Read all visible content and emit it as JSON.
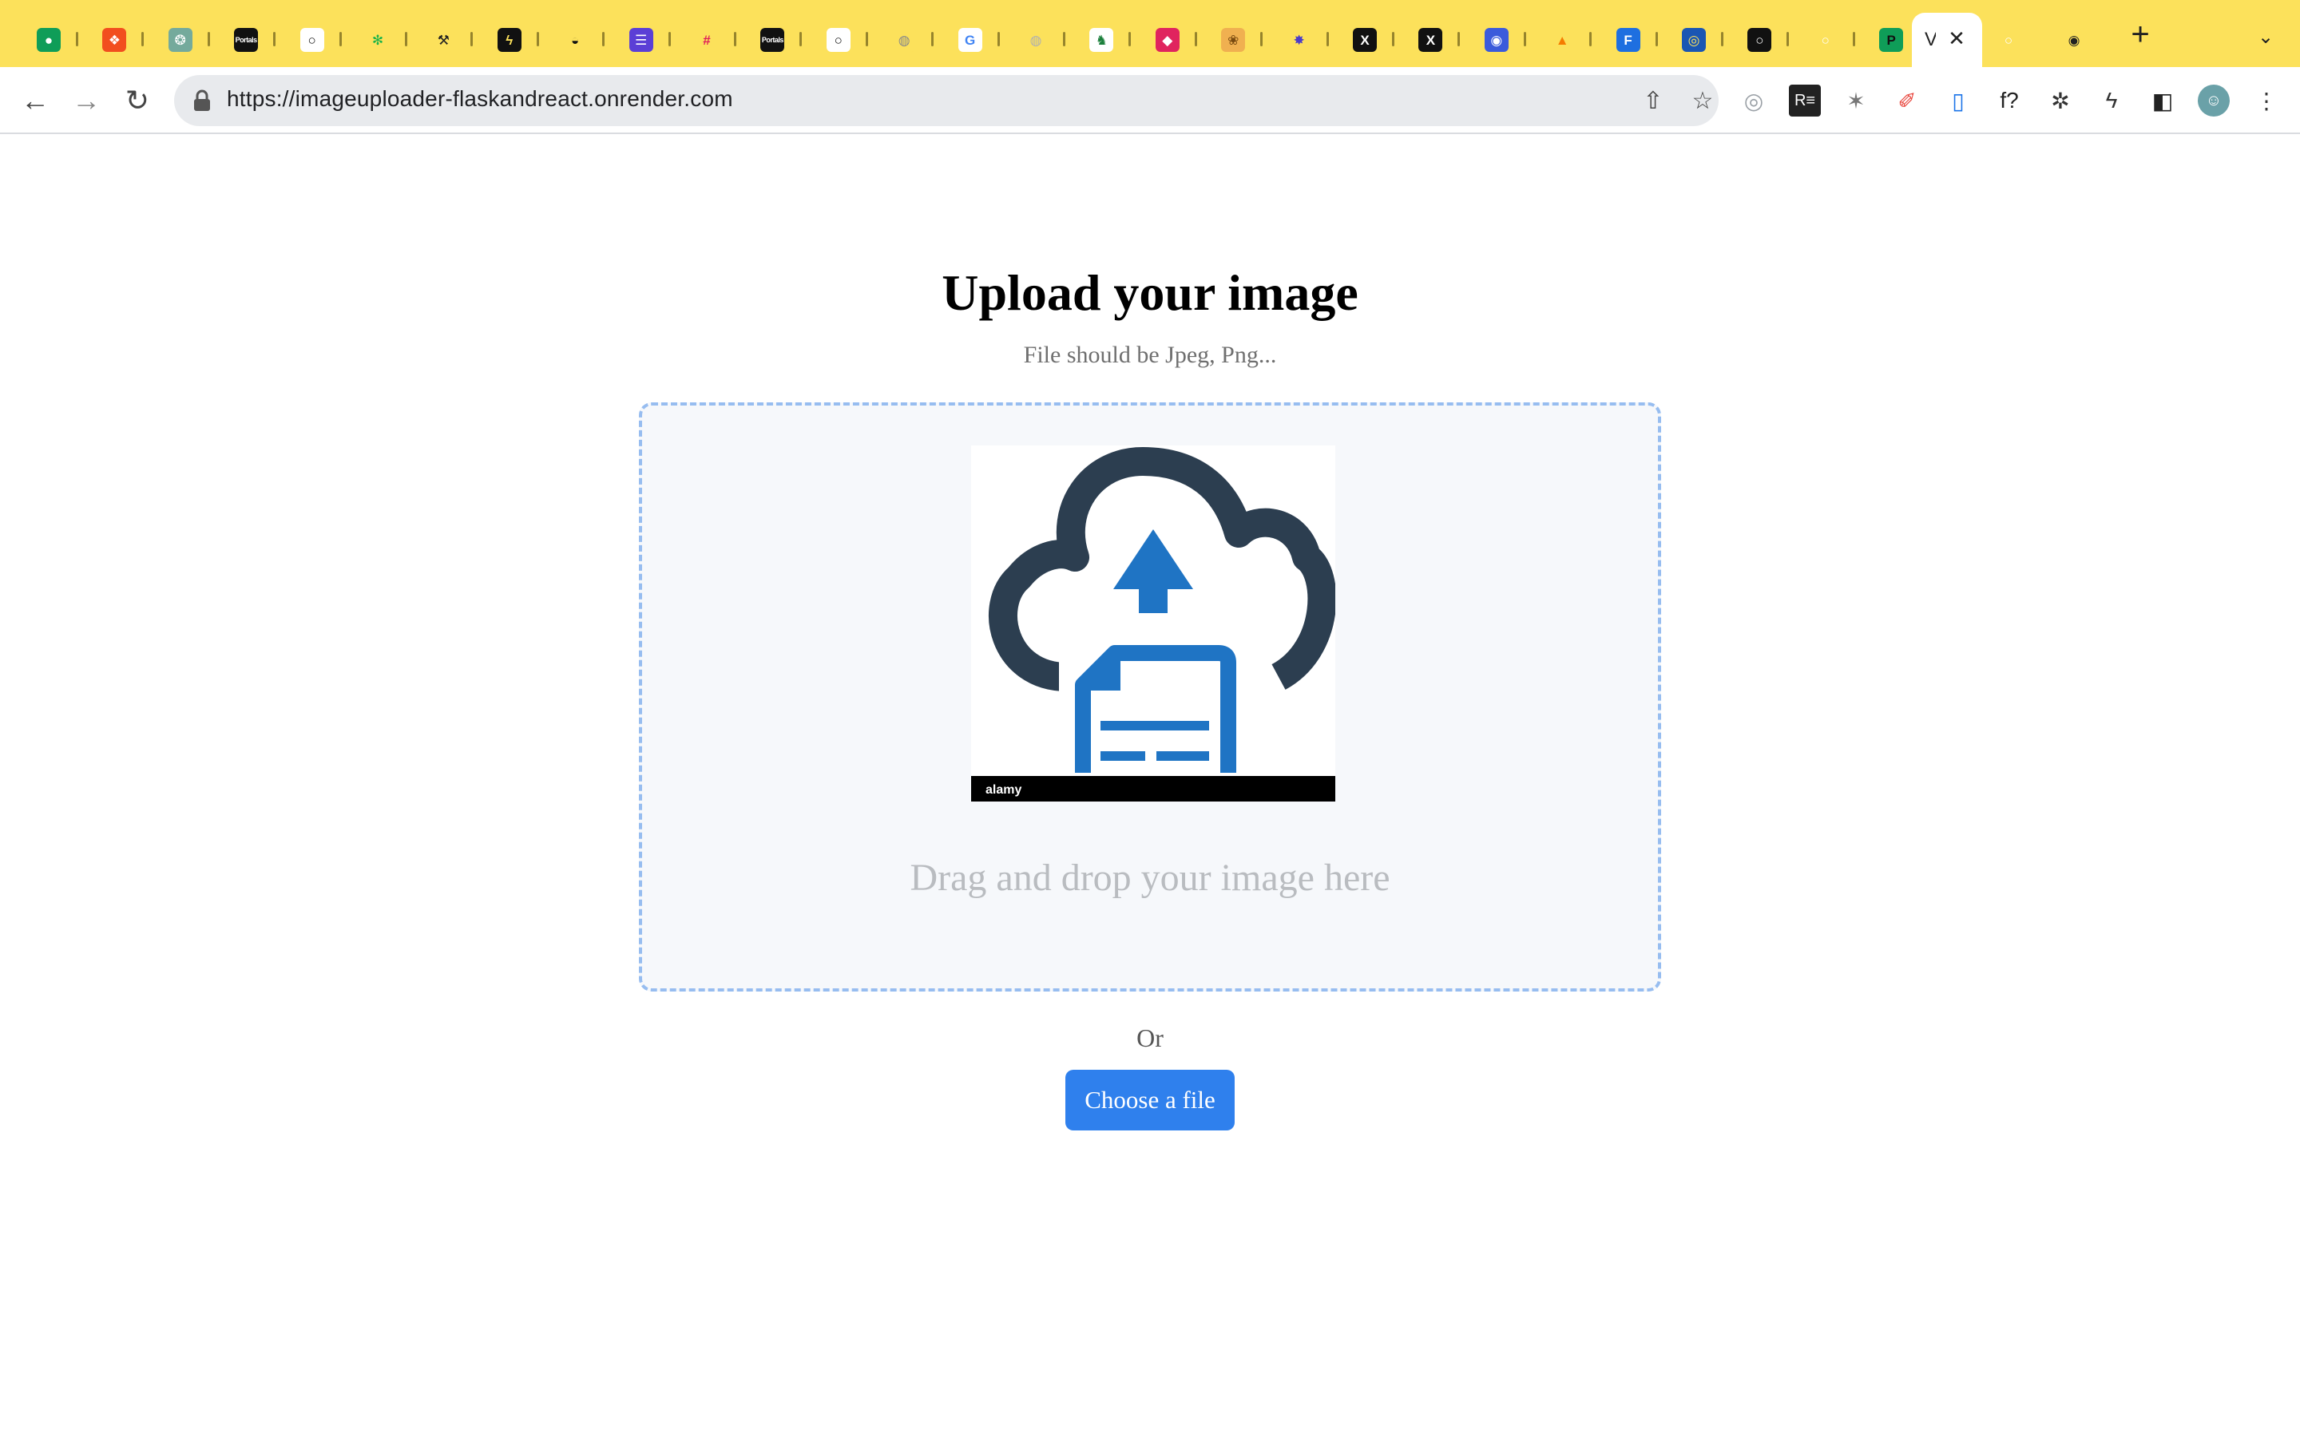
{
  "browser": {
    "tabs": [
      {
        "icon": "sheets-icon",
        "glyph": "●",
        "bg": "#0f9d58",
        "fg": "#ffffff"
      },
      {
        "icon": "figma-icon",
        "glyph": "❖",
        "bg": "#f24e1e",
        "fg": "#ffffff"
      },
      {
        "icon": "chatgpt-icon",
        "glyph": "❂",
        "bg": "#74aa9c",
        "fg": "#ffffff"
      },
      {
        "icon": "portals-icon",
        "glyph": "Portals",
        "bg": "#111111",
        "fg": "#ffffff"
      },
      {
        "icon": "github-icon",
        "glyph": "○",
        "bg": "#ffffff",
        "fg": "#111111"
      },
      {
        "icon": "asterisk-icon",
        "glyph": "✻",
        "bg": "#fce15b",
        "fg": "#19b34a"
      },
      {
        "icon": "tools-icon",
        "glyph": "⚒",
        "bg": "#fce15b",
        "fg": "#222222"
      },
      {
        "icon": "zap-icon",
        "glyph": "ϟ",
        "bg": "#111111",
        "fg": "#fce15b"
      },
      {
        "icon": "dark-circle-icon",
        "glyph": "◒",
        "bg": "#fce15b",
        "fg": "#111111"
      },
      {
        "icon": "list-app-icon",
        "glyph": "☰",
        "bg": "#5b3fd6",
        "fg": "#ffffff"
      },
      {
        "icon": "slack-icon",
        "glyph": "#",
        "bg": "#fce15b",
        "fg": "#e01e5a"
      },
      {
        "icon": "portals-icon",
        "glyph": "Portals",
        "bg": "#111111",
        "fg": "#ffffff"
      },
      {
        "icon": "github-icon",
        "glyph": "○",
        "bg": "#ffffff",
        "fg": "#111111"
      },
      {
        "icon": "globe-icon",
        "glyph": "◍",
        "bg": "#fce15b",
        "fg": "#8a8a8a"
      },
      {
        "icon": "google-icon",
        "glyph": "G",
        "bg": "#ffffff",
        "fg": "#4285f4"
      },
      {
        "icon": "globe-icon",
        "glyph": "◍",
        "bg": "#fce15b",
        "fg": "#b0b0b0"
      },
      {
        "icon": "horse-icon",
        "glyph": "♞",
        "bg": "#ffffff",
        "fg": "#1b7f3b"
      },
      {
        "icon": "ruby-icon",
        "glyph": "◆",
        "bg": "#e0245e",
        "fg": "#ffffff"
      },
      {
        "icon": "cat-icon",
        "glyph": "❀",
        "bg": "#f0b050",
        "fg": "#7a4a10"
      },
      {
        "icon": "flower-icon",
        "glyph": "✸",
        "bg": "#fce15b",
        "fg": "#4b3cc8"
      },
      {
        "icon": "x-icon",
        "glyph": "X",
        "bg": "#111111",
        "fg": "#ffffff"
      },
      {
        "icon": "x-icon",
        "glyph": "X",
        "bg": "#111111",
        "fg": "#ffffff"
      },
      {
        "icon": "avatar-globe-icon",
        "glyph": "◉",
        "bg": "#3b5bdb",
        "fg": "#ffffff"
      },
      {
        "icon": "firebase-icon",
        "glyph": "▲",
        "bg": "#fce15b",
        "fg": "#f57c00"
      },
      {
        "icon": "f-app-icon",
        "glyph": "F",
        "bg": "#1e6fe0",
        "fg": "#ffffff"
      },
      {
        "icon": "target-icon",
        "glyph": "◎",
        "bg": "#1a56b3",
        "fg": "#fce15b"
      },
      {
        "icon": "github-icon",
        "glyph": "○",
        "bg": "#111111",
        "fg": "#ffffff"
      },
      {
        "icon": "github-icon",
        "glyph": "○",
        "bg": "#fce15b",
        "fg": "#ffffff"
      },
      {
        "icon": "p-app-icon",
        "glyph": "P",
        "bg": "#0f9d58",
        "fg": "#111111"
      }
    ],
    "active_tab": {
      "label": "V",
      "close_glyph": "✕"
    },
    "after_tabs": [
      {
        "icon": "github-icon",
        "glyph": "○",
        "bg": "#fce15b",
        "fg": "#ffffff"
      },
      {
        "icon": "chrome-icon",
        "glyph": "◉",
        "bg": "#fce15b",
        "fg": "#222222"
      }
    ],
    "new_tab_glyph": "+",
    "tab_search_glyph": "⌄",
    "nav": {
      "back": "←",
      "forward": "→",
      "reload": "↻"
    },
    "url": "https://imageuploader-flaskandreact.onrender.com",
    "omnibox_icons": {
      "share": "⇧",
      "bookmark": "☆"
    },
    "extensions": [
      {
        "name": "dev-tools-extension-icon",
        "glyph": "◎",
        "color": "#9aa0a6"
      },
      {
        "name": "reader-extension-icon",
        "glyph": "R≡",
        "color": "#ffffff",
        "bg": "#222222"
      },
      {
        "name": "bug-extension-icon",
        "glyph": "✶",
        "color": "#777777"
      },
      {
        "name": "color-picker-extension-icon",
        "glyph": "✐",
        "color": "#e8453c"
      },
      {
        "name": "clipboard-extension-icon",
        "glyph": "▯",
        "color": "#1a73e8"
      },
      {
        "name": "font-finder-extension-icon",
        "glyph": "f?",
        "color": "#222222"
      },
      {
        "name": "puzzle-extensions-icon",
        "glyph": "✲",
        "color": "#333333"
      },
      {
        "name": "bolt-extension-icon",
        "glyph": "ϟ",
        "color": "#333333"
      },
      {
        "name": "side-panel-icon",
        "glyph": "◧",
        "color": "#222222"
      },
      {
        "name": "profile-avatar",
        "glyph": "☺",
        "color": "#ffffff",
        "bg": "#6aa1a8"
      },
      {
        "name": "menu-kebab-icon",
        "glyph": "⋮",
        "color": "#333333"
      }
    ]
  },
  "page": {
    "title": "Upload your image",
    "subtitle": "File should be Jpeg, Png...",
    "dropzone": {
      "image_watermark": "alamy",
      "drop_text": "Drag and drop your image here"
    },
    "or_text": "Or",
    "choose_button": "Choose a file"
  },
  "colors": {
    "tab_strip": "#fce15b",
    "button_accent": "#2f80ed",
    "dropzone_border": "#97bdf0",
    "cloud_dark": "#2c3e50",
    "upload_blue": "#1f74c4"
  }
}
